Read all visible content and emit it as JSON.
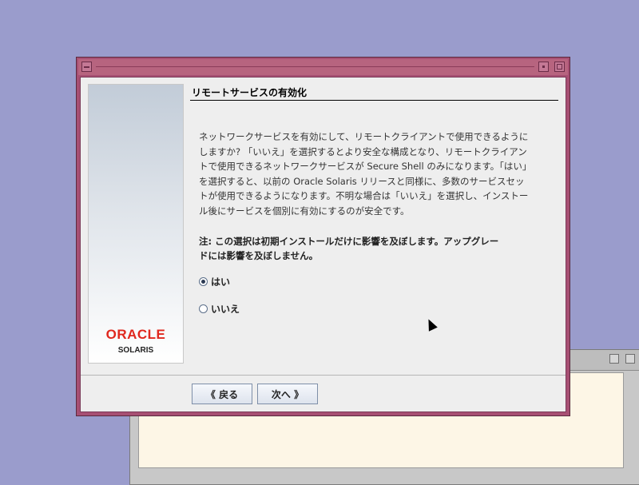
{
  "dialog": {
    "heading": "リモートサービスの有効化",
    "description_lines": [
      "ネットワークサービスを有効にして、リモートクライアントで使用できるように",
      "しますか? 「いいえ」を選択するとより安全な構成となり、リモートクライアン",
      "トで使用できるネットワークサービスが Secure Shell のみになります。「はい」",
      "を選択すると、以前の Oracle Solaris リリースと同様に、多数のサービスセッ",
      "トが使用できるようになります。不明な場合は「いいえ」を選択し、インストー",
      "ル後にサービスを個別に有効にするのが安全です。"
    ],
    "note_lines": [
      "注: この選択は初期インストールだけに影響を及ぼします。アップグレー",
      "ドには影響を及ぼしません。"
    ],
    "options": [
      {
        "label": "はい",
        "selected": true
      },
      {
        "label": "いいえ",
        "selected": false
      }
    ],
    "back_label": "《 戻る",
    "next_label": "次へ 》"
  },
  "branding": {
    "logo": "ORACLE",
    "product": "SOLARIS",
    "logo_color": "#e0281e"
  },
  "icons": {
    "window_menu": "window-menu-icon",
    "minimize": "minimize-icon",
    "maximize": "maximize-icon",
    "cursor": "mouse-pointer-icon"
  },
  "colors": {
    "desktop": "#9a9ccc",
    "window_frame": "#a74f73",
    "dialog_bg": "#eeeeee"
  }
}
